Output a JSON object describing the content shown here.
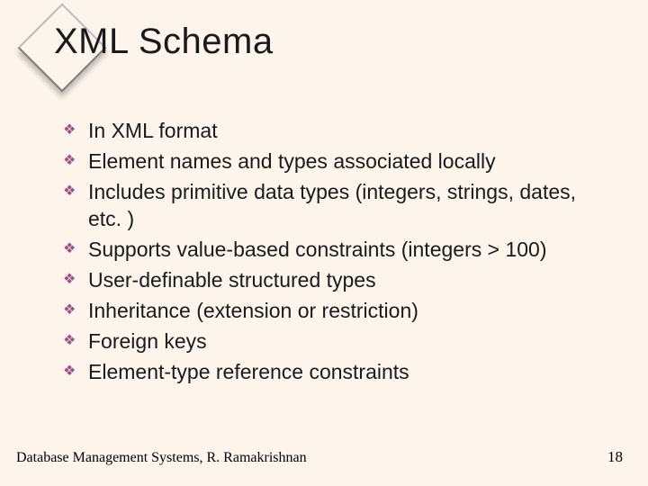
{
  "title": "XML Schema",
  "bullets": [
    "In XML format",
    "Element names and types associated locally",
    "Includes primitive data types (integers, strings, dates, etc. )",
    "Supports value-based constraints (integers > 100)",
    "User-definable structured types",
    "Inheritance (extension or restriction)",
    "Foreign keys",
    "Element-type reference constraints"
  ],
  "footer_left": "Database Management Systems, R. Ramakrishnan",
  "footer_right": "18"
}
